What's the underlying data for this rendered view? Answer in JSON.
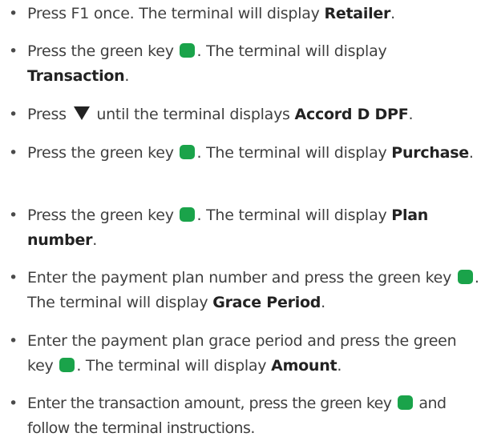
{
  "colors": {
    "green_key": "#1aa34a",
    "text": "#3f3f3f",
    "bold_text": "#222222"
  },
  "icons": {
    "green_key": "green-key-icon",
    "down_arrow": "down-arrow-icon"
  },
  "bullet": "•",
  "steps": [
    {
      "a": "Press F1 once. The terminal will display ",
      "bold": "Retailer",
      "c": "."
    },
    {
      "a": "Press the green key ",
      "b": ". The terminal will display ",
      "bold": "Transaction",
      "c": "."
    },
    {
      "a": "Press ",
      "b": " until the terminal displays ",
      "bold": "Accord D DPF",
      "c": "."
    },
    {
      "a": "Press the green key ",
      "b": ". The terminal will display ",
      "bold": "Purchase",
      "c": "."
    },
    {
      "a": "Press the green key ",
      "b": ". The terminal will display ",
      "bold": "Plan number",
      "c": "."
    },
    {
      "a": "Enter the payment plan number and press the green key ",
      "b": ". The terminal will display ",
      "bold": "Grace Period",
      "c": "."
    },
    {
      "a": "Enter the payment plan grace period and press the green key ",
      "b": ". The terminal will display ",
      "bold": "Amount",
      "c": "."
    },
    {
      "a": "Enter the transaction amount, press the green key ",
      "b": " and follow the terminal instructions."
    }
  ]
}
